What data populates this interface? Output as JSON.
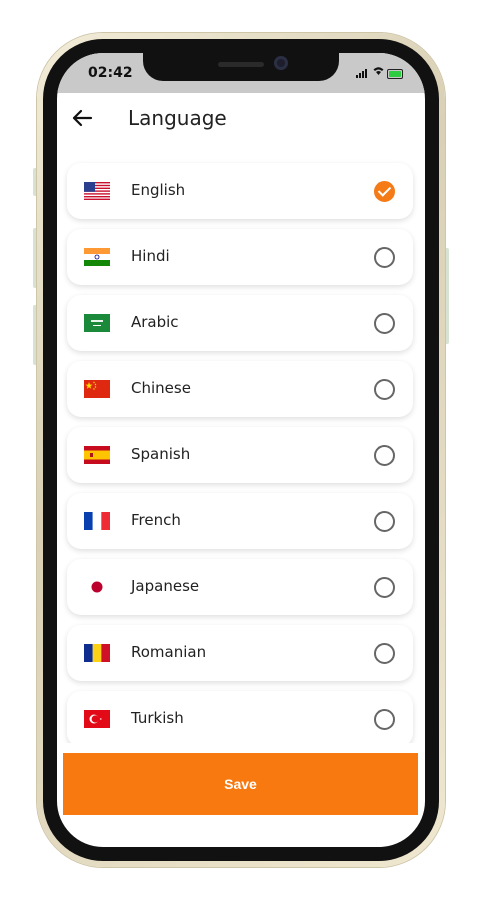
{
  "status_bar": {
    "time": "02:42",
    "wifi_icon": "wifi-icon",
    "battery_color": "#2ecc40"
  },
  "header": {
    "title": "Language",
    "back_icon": "arrow-left-icon"
  },
  "languages": [
    {
      "name": "English",
      "flag": "us-flag-icon",
      "selected": true
    },
    {
      "name": "Hindi",
      "flag": "india-flag-icon",
      "selected": false
    },
    {
      "name": "Arabic",
      "flag": "saudi-flag-icon",
      "selected": false
    },
    {
      "name": "Chinese",
      "flag": "china-flag-icon",
      "selected": false
    },
    {
      "name": "Spanish",
      "flag": "spain-flag-icon",
      "selected": false
    },
    {
      "name": "French",
      "flag": "france-flag-icon",
      "selected": false
    },
    {
      "name": "Japanese",
      "flag": "japan-flag-icon",
      "selected": false
    },
    {
      "name": "Romanian",
      "flag": "romania-flag-icon",
      "selected": false
    },
    {
      "name": "Turkish",
      "flag": "turkey-flag-icon",
      "selected": false
    }
  ],
  "save_button": {
    "label": "Save"
  },
  "colors": {
    "accent": "#f7790f",
    "check": "#f47b16"
  }
}
